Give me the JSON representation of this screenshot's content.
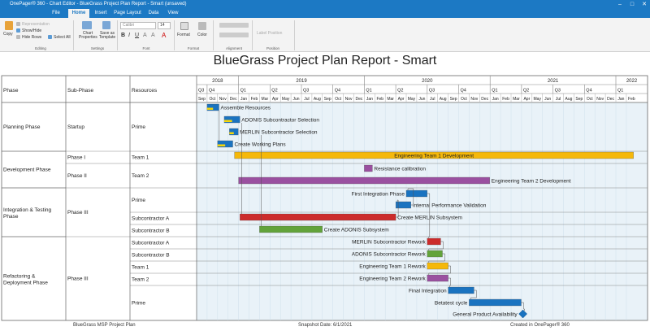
{
  "app": {
    "title": "OnePager® 360 - Chart Editor - BlueGrass Project Plan Report - Smart (unsaved)",
    "tabs": [
      "File",
      "Home",
      "Insert",
      "Page Layout",
      "Data",
      "View"
    ],
    "active_tab": "Home"
  },
  "ribbon": {
    "copy": "Copy",
    "representation": "Representation",
    "show_hide": "Show/Hide",
    "hide_rows": "Hide Rows",
    "select_all": "Select All",
    "chart_properties": "Chart Properties",
    "save_as_template": "Save as Template",
    "font_name": "Calibri",
    "font_size": "14",
    "format": "Format",
    "color": "Color",
    "label_position": "Label Position",
    "groups": [
      "Editing",
      "Settings",
      "Font",
      "Format",
      "Alignment",
      "Position"
    ]
  },
  "chart": {
    "title": "BlueGrass Project Plan Report - Smart",
    "headers": {
      "phase": "Phase",
      "subphase": "Sub-Phase",
      "resources": "Resources"
    },
    "years": [
      "2018",
      "2019",
      "2020",
      "2021",
      "2022"
    ],
    "quarters": [
      "Q3",
      "Q4",
      "Q1",
      "Q2",
      "Q3",
      "Q4",
      "Q1",
      "Q2",
      "Q3",
      "Q4",
      "Q1",
      "Q2",
      "Q3",
      "Q4",
      "Q1"
    ],
    "months": [
      "Sep",
      "Oct",
      "Nov",
      "Dec",
      "Jan",
      "Feb",
      "Mar",
      "Apr",
      "May",
      "Jun",
      "Jul",
      "Aug",
      "Sep",
      "Oct",
      "Nov",
      "Dec",
      "Jan",
      "Feb",
      "Mar",
      "Apr",
      "May",
      "Jun",
      "Jul",
      "Aug",
      "Sep",
      "Oct",
      "Nov",
      "Dec",
      "Jan",
      "Feb",
      "Mar",
      "Apr",
      "May",
      "Jun",
      "Jul",
      "Aug",
      "Sep",
      "Oct",
      "Nov",
      "Dec",
      "Jan",
      "Feb"
    ],
    "phases": [
      {
        "name": "Planning Phase"
      },
      {
        "name": "Development Phase"
      },
      {
        "name": "Integration & Testing Phase"
      },
      {
        "name": "Refactoring & Deployment Phase"
      }
    ],
    "subphases": [
      "Startup",
      "Phase I",
      "Phase II",
      "Phase III",
      "Phase III"
    ],
    "resources": [
      "Prime",
      "Team 1",
      "Team 2",
      "Prime",
      "Subcontractor A",
      "Subcontractor B",
      "Subcontractor A",
      "Subcontractor B",
      "Team 1",
      "Team 2",
      "Prime"
    ],
    "tasks": [
      {
        "label": "Assemble Resources",
        "start": "2018-10-01",
        "end": "2018-11-05",
        "color": "#1a73c0",
        "progress": 0.5
      },
      {
        "label": "ADONIS Subcontractor Selection",
        "start": "2018-11-20",
        "end": "2019-01-05",
        "color": "#1a73c0",
        "progress": 0.5
      },
      {
        "label": "MERLIN Subcontractor Selection",
        "start": "2018-12-05",
        "end": "2018-12-31",
        "color": "#1a73c0",
        "progress": 0.5
      },
      {
        "label": "Create Working Plans",
        "start": "2018-11-01",
        "end": "2018-12-15",
        "color": "#1a73c0",
        "progress": 0.5
      },
      {
        "label": "Engineering Team 1 Development",
        "start": "2018-12-20",
        "end": "2022-02-20",
        "color": "#f5b80a",
        "progress": 0.0
      },
      {
        "label": "Resistance calibration",
        "start": "2020-01-01",
        "end": "2020-01-25",
        "color": "#9a50a0",
        "progress": 0.0
      },
      {
        "label": "Engineering Team 2 Development",
        "start": "2019-01-01",
        "end": "2020-12-31",
        "color": "#9a50a0",
        "progress": 0.0
      },
      {
        "label": "First Integration Phase",
        "start": "2020-05-01",
        "end": "2020-07-01",
        "color": "#1a73c0",
        "progress": 0.0
      },
      {
        "label": "Internal Performance Validation",
        "start": "2020-04-01",
        "end": "2020-05-15",
        "color": "#1a73c0",
        "progress": 0.0
      },
      {
        "label": "Create MERLIN Subsystem",
        "start": "2019-01-05",
        "end": "2020-04-01",
        "color": "#cc2b2b",
        "progress": 0.0
      },
      {
        "label": "Create ADONIS Subsystem",
        "start": "2019-03-01",
        "end": "2019-09-01",
        "color": "#62a33a",
        "progress": 0.0
      },
      {
        "label": "MERLIN Subcontractor Rework",
        "start": "2020-07-01",
        "end": "2020-08-10",
        "color": "#cc2b2b",
        "progress": 0.0
      },
      {
        "label": "ADONIS Subcontractor Rework",
        "start": "2020-07-01",
        "end": "2020-08-15",
        "color": "#62a33a",
        "progress": 0.0
      },
      {
        "label": "Engineering Team 1 Rework",
        "start": "2020-07-01",
        "end": "2020-09-01",
        "color": "#f5b80a",
        "progress": 0.0
      },
      {
        "label": "Engineering Team 2 Rework",
        "start": "2020-07-01",
        "end": "2020-09-01",
        "color": "#9a50a0",
        "progress": 0.0
      },
      {
        "label": "Final Integration",
        "start": "2020-09-01",
        "end": "2020-11-15",
        "color": "#1a73c0",
        "progress": 0.0
      },
      {
        "label": "Betatest cycle",
        "start": "2020-11-01",
        "end": "2021-03-31",
        "color": "#1a73c0",
        "progress": 0.0
      },
      {
        "label": "General Product Availability",
        "date": "2021-04-05",
        "color": "#1a73c0",
        "type": "milestone"
      }
    ]
  },
  "footer": {
    "left": "BlueGrass MSP Project Plan",
    "center": "Snapshot Date: 6/1/2021",
    "right": "Created in OnePager® 360"
  }
}
